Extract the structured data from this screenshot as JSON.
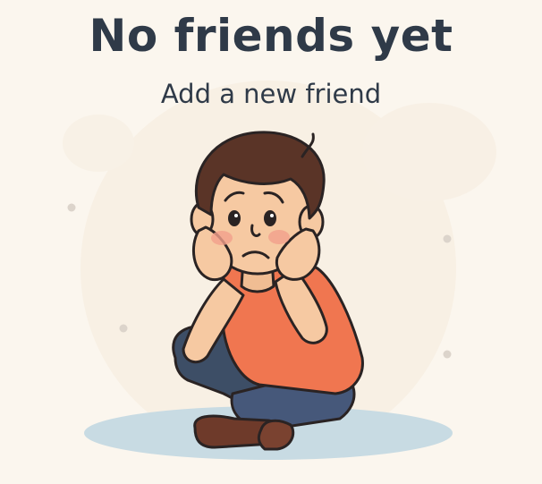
{
  "empty_state": {
    "title": "No friends yet",
    "action_label": "Add a new friend",
    "illustration_icon": "sad-boy-illustration"
  },
  "colors": {
    "background": "#fbf6ee",
    "text": "#2f3a48",
    "shirt": "#f07650",
    "pants": "#3d4e66",
    "hair": "#5a3427",
    "skin": "#f6c9a2",
    "shoes": "#6e3a2a",
    "shadow": "#c8dbe3"
  }
}
